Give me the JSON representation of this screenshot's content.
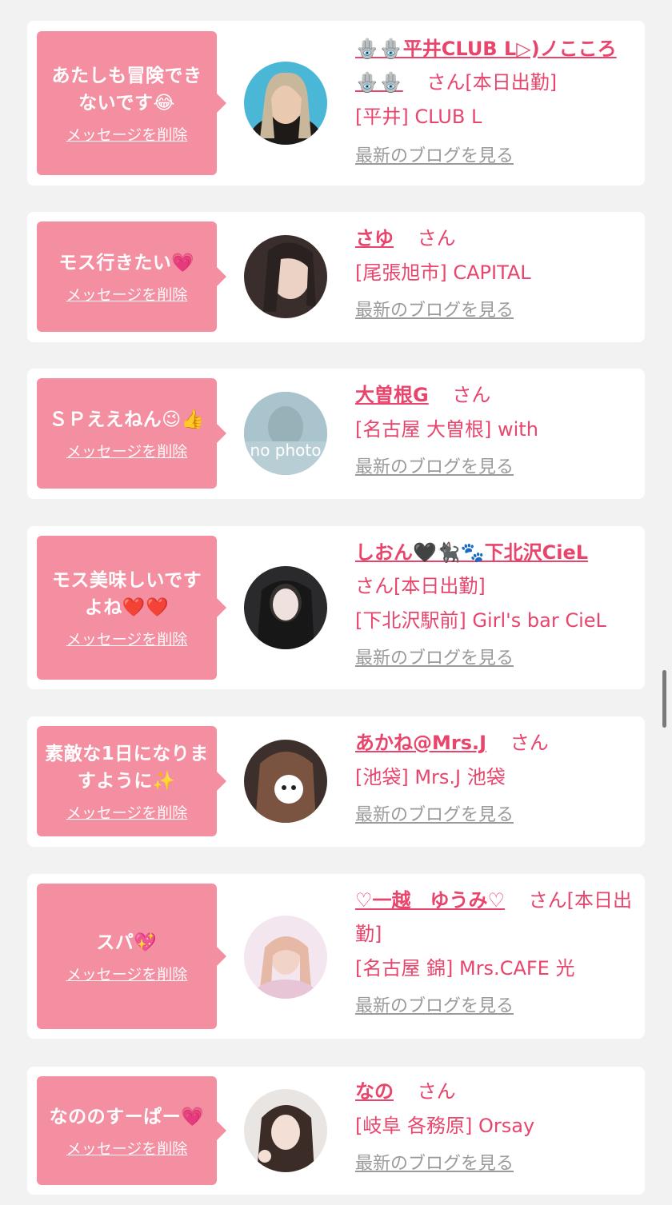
{
  "delete_label": "メッセージを削除",
  "blog_label": "最新のブログを見る",
  "san_label": "さん",
  "colors": {
    "background": "#f2f2f3",
    "bubble": "#f48fa2",
    "accent": "#e8456c",
    "link_gray": "#9a9a9a"
  },
  "items": [
    {
      "message": "あたしも冒険できないです😂",
      "name": "🪬🪬平井CLUB L▷)ノこころ🪬🪬",
      "suffix": "さん[本日出勤]",
      "shop": "[平井] CLUB L",
      "avatar": "avatar-photo"
    },
    {
      "message": "モス行きたい💗",
      "name": "さゆ",
      "suffix": "さん",
      "shop": "[尾張旭市] CAPITAL",
      "avatar": "avatar-photo"
    },
    {
      "message": "ＳＰええねん😉👍",
      "name": "大曽根G",
      "suffix": "さん",
      "shop": "[名古屋 大曽根] with",
      "avatar": "no-photo",
      "avatar_text": "no photo"
    },
    {
      "message": "モス美味しいですよね❤️❤️",
      "name": "しおん🖤🐈‍⬛🐾下北沢CieL",
      "suffix": "さん[本日出勤]",
      "shop": "[下北沢駅前] Girl's bar CieL",
      "avatar": "avatar-photo"
    },
    {
      "message": "素敵な1日になりますように✨",
      "name": "あかね@Mrs.J",
      "suffix": "さん",
      "shop": "[池袋] Mrs.J 池袋",
      "avatar": "avatar-photo"
    },
    {
      "message": "スパ💖",
      "name": "♡一越　ゆうみ♡",
      "suffix": "さん[本日出勤]",
      "shop": "[名古屋 錦] Mrs.CAFE 光",
      "avatar": "avatar-photo"
    },
    {
      "message": "なののすーぱー💗",
      "name": "なの",
      "suffix": "さん",
      "shop": "[岐阜 各務原] Orsay",
      "avatar": "avatar-photo"
    }
  ]
}
